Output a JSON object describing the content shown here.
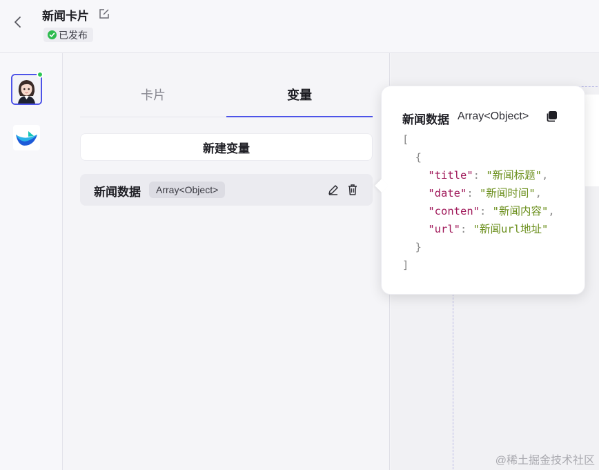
{
  "header": {
    "title": "新闻卡片",
    "status": "已发布"
  },
  "colors": {
    "accent": "#4d53e8",
    "status_green": "#2dbb4e",
    "json_key": "#a0195a",
    "json_string": "#6b8f1c"
  },
  "tabs": [
    {
      "label": "卡片",
      "active": false
    },
    {
      "label": "变量",
      "active": true
    }
  ],
  "new_variable_label": "新建变量",
  "variable": {
    "name": "新闻数据",
    "type": "Array<Object>"
  },
  "popover": {
    "name": "新闻数据",
    "type": "Array<Object>",
    "code": {
      "open_bracket": "[",
      "open_brace": "{",
      "fields": [
        {
          "key": "\"title\"",
          "value": "\"新闻标题\""
        },
        {
          "key": "\"date\"",
          "value": "\"新闻时间\""
        },
        {
          "key": "\"conten\"",
          "value": "\"新闻内容\""
        },
        {
          "key": "\"url\"",
          "value": "\"新闻url地址\""
        }
      ],
      "close_brace": "}",
      "close_bracket": "]"
    }
  },
  "icons": {
    "back": "chevron-left-icon",
    "edit": "edit-icon",
    "status": "check-circle-icon",
    "delete": "trash-icon",
    "copy": "copy-icon"
  },
  "watermark": "@稀土掘金技术社区"
}
